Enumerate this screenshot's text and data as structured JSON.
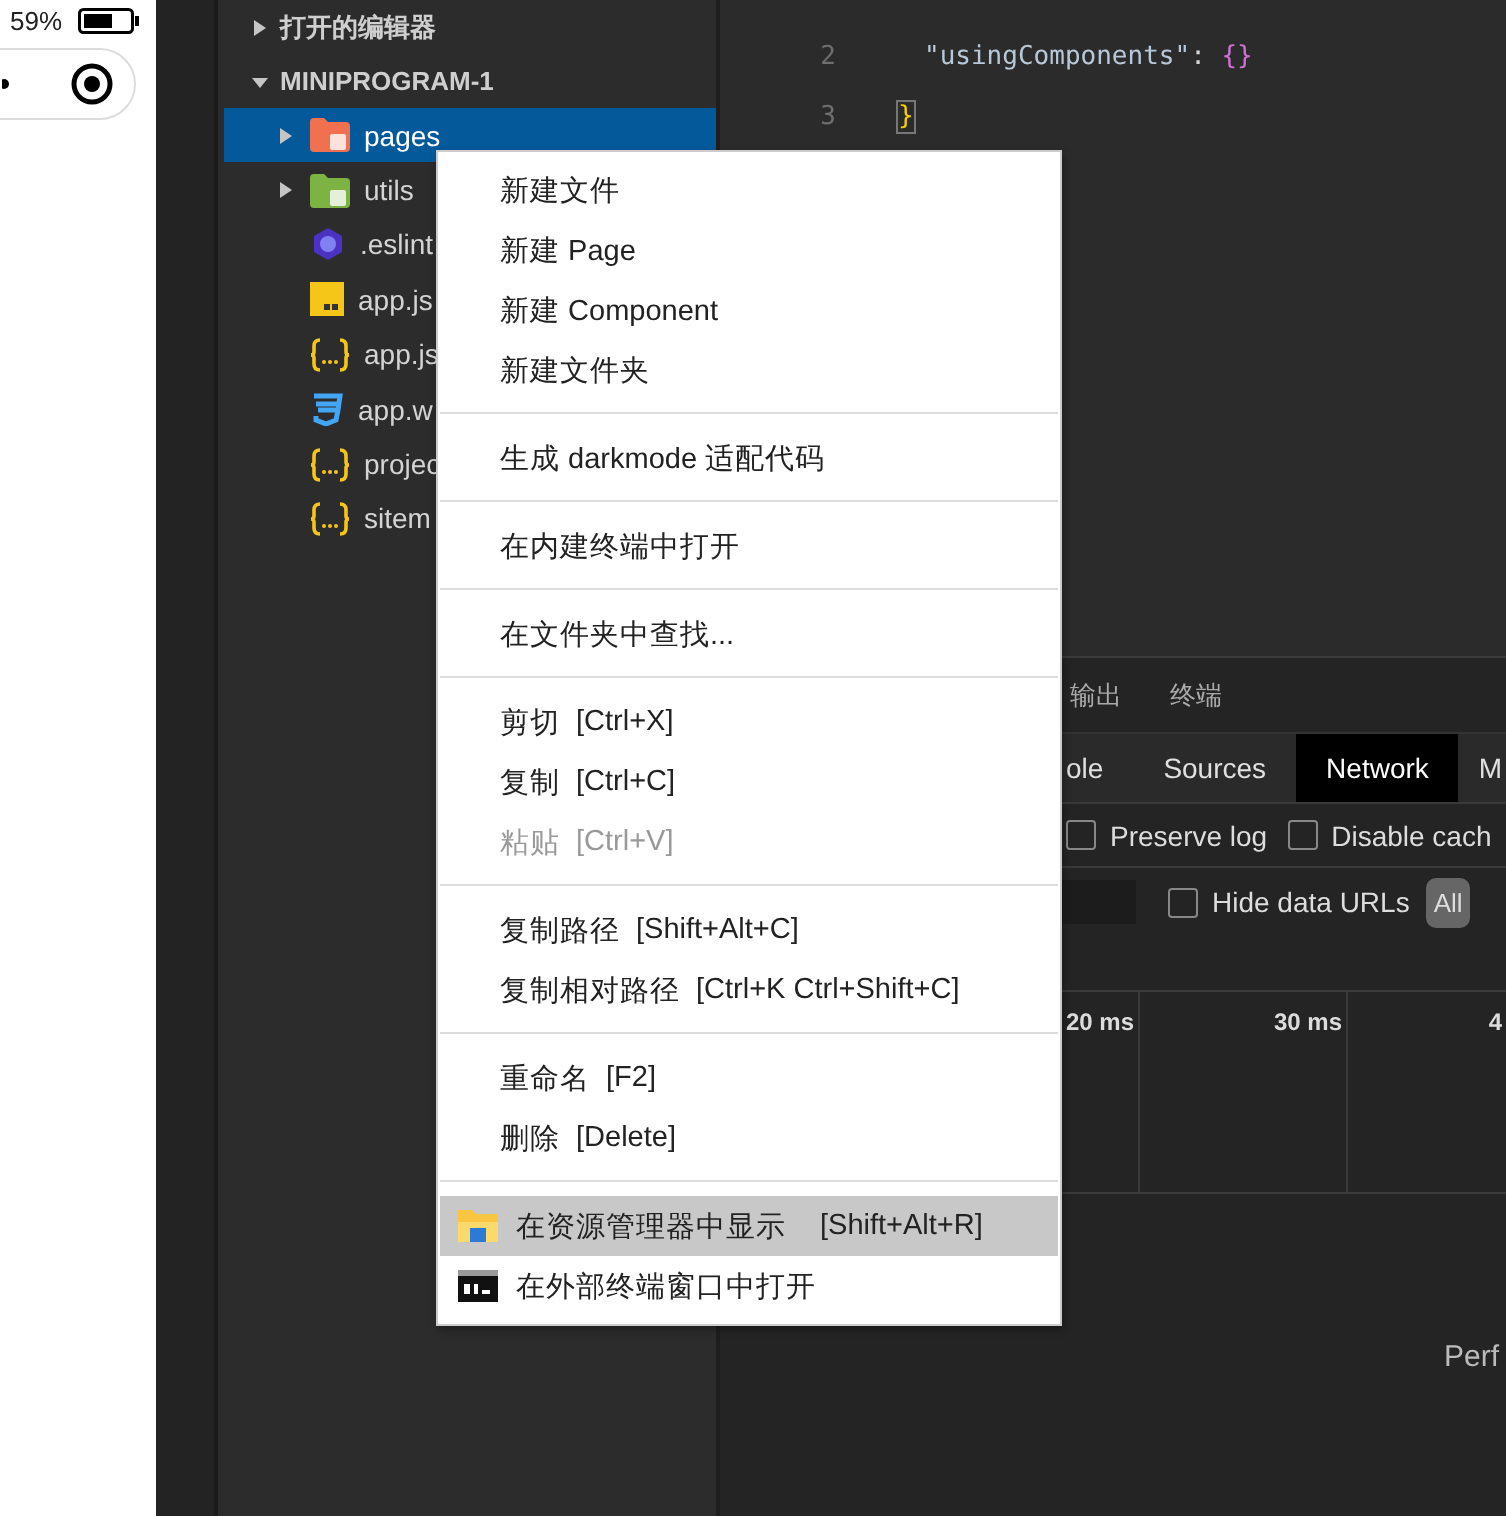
{
  "phone": {
    "battery": "59%"
  },
  "sidebar": {
    "open_editors": {
      "label": "打开的编辑器",
      "expanded": false
    },
    "project": {
      "label": "MINIPROGRAM-1",
      "expanded": true,
      "children": [
        {
          "name": "pages",
          "kind": "folder",
          "color": "#f0704f",
          "expanded": false,
          "selected": true
        },
        {
          "name": "utils",
          "kind": "folder",
          "color": "#7cb342",
          "expanded": false,
          "selected": false
        },
        {
          "name": ".eslint",
          "kind": "eslint",
          "selected": false
        },
        {
          "name": "app.js",
          "kind": "js",
          "selected": false
        },
        {
          "name": "app.js",
          "kind": "json",
          "selected": false
        },
        {
          "name": "app.w",
          "kind": "css",
          "selected": false
        },
        {
          "name": "projec",
          "kind": "json",
          "selected": false
        },
        {
          "name": "sitem",
          "kind": "json",
          "selected": false
        }
      ]
    }
  },
  "editor": {
    "lines": [
      {
        "number": "2",
        "tokens": [
          {
            "text": "\"usingComponents\"",
            "kind": "string"
          },
          {
            "text": ": ",
            "kind": "punct"
          },
          {
            "text": "{}",
            "kind": "brace"
          }
        ]
      },
      {
        "number": "3",
        "tokens": [
          {
            "text": "}",
            "kind": "match"
          }
        ]
      }
    ]
  },
  "bottom_panel": {
    "tabs": [
      {
        "label": "输出",
        "selected": false
      },
      {
        "label": "终端",
        "selected": false
      }
    ],
    "devtools_tabs": [
      {
        "label": "ole",
        "selected": false
      },
      {
        "label": "Sources",
        "selected": false
      },
      {
        "label": "Network",
        "selected": true
      },
      {
        "label": "M",
        "selected": false
      }
    ],
    "options": [
      {
        "label": "Preserve log",
        "checked": false
      },
      {
        "label": "Disable cach",
        "checked": false
      }
    ],
    "hide_data_urls": {
      "label": "Hide data URLs",
      "checked": false
    },
    "all_button": {
      "label": "All",
      "selected": true
    },
    "timeline_ticks": [
      "20 ms",
      "30 ms",
      "4"
    ],
    "message": "Perf"
  },
  "context_menu": {
    "groups": [
      [
        {
          "label": "新建文件",
          "kind": "plain",
          "disabled": false,
          "selected": false
        },
        {
          "label": "新建 Page",
          "kind": "plain",
          "disabled": false,
          "selected": false
        },
        {
          "label": "新建 Component",
          "kind": "plain",
          "disabled": false,
          "selected": false
        },
        {
          "label": "新建文件夹",
          "kind": "plain",
          "disabled": false,
          "selected": false
        }
      ],
      [
        {
          "label": "生成 darkmode 适配代码",
          "kind": "plain",
          "disabled": false,
          "selected": false
        }
      ],
      [
        {
          "label": "在内建终端中打开",
          "kind": "plain",
          "disabled": false,
          "selected": false
        }
      ],
      [
        {
          "label": "在文件夹中查找...",
          "kind": "plain",
          "disabled": false,
          "selected": false
        }
      ],
      [
        {
          "label": "剪切",
          "shortcut": "[Ctrl+X]",
          "kind": "plain",
          "disabled": false,
          "selected": false
        },
        {
          "label": "复制",
          "shortcut": "[Ctrl+C]",
          "kind": "plain",
          "disabled": false,
          "selected": false
        },
        {
          "label": "粘贴",
          "shortcut": "[Ctrl+V]",
          "kind": "plain",
          "disabled": true,
          "selected": false
        }
      ],
      [
        {
          "label": "复制路径",
          "shortcut": "[Shift+Alt+C]",
          "kind": "plain",
          "disabled": false,
          "selected": false
        },
        {
          "label": "复制相对路径",
          "shortcut": "[Ctrl+K Ctrl+Shift+C]",
          "kind": "plain",
          "disabled": false,
          "selected": false
        }
      ],
      [
        {
          "label": "重命名",
          "shortcut": "[F2]",
          "kind": "plain",
          "disabled": false,
          "selected": false
        },
        {
          "label": "删除",
          "shortcut": "[Delete]",
          "kind": "plain",
          "disabled": false,
          "selected": false
        }
      ],
      [
        {
          "label": "在资源管理器中显示",
          "shortcut": "[Shift+Alt+R]",
          "kind": "explorer",
          "disabled": false,
          "selected": true
        },
        {
          "label": "在外部终端窗口中打开",
          "kind": "console",
          "disabled": false,
          "selected": false
        }
      ]
    ]
  }
}
